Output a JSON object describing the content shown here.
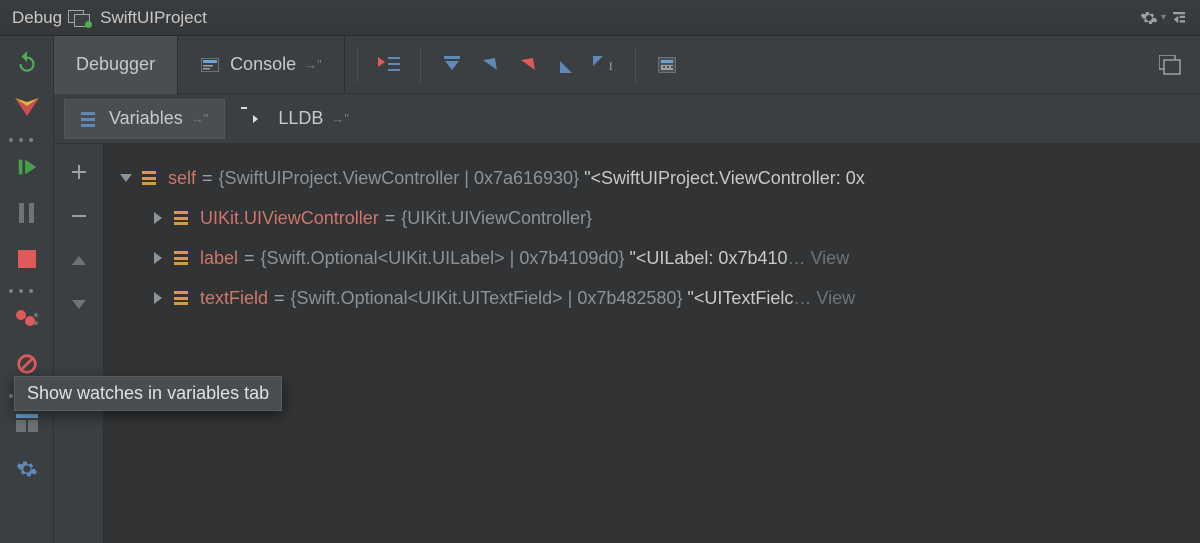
{
  "titleBar": {
    "title": "Debug",
    "projectName": "SwiftUIProject"
  },
  "toolbar": {
    "tabDebugger": "Debugger",
    "tabConsole": "Console"
  },
  "subTabs": {
    "variables": "Variables",
    "lldb": "LLDB"
  },
  "tooltip": "Show watches in variables tab",
  "variables": {
    "root": {
      "name": "self",
      "type": "{SwiftUIProject.ViewController | 0x7a616930}",
      "desc": "\"<SwiftUIProject.ViewController: 0x"
    },
    "children": [
      {
        "name": "UIKit.UIViewController",
        "type": "{UIKit.UIViewController}",
        "desc": ""
      },
      {
        "name": "label",
        "type": "{Swift.Optional<UIKit.UILabel> | 0x7b4109d0}",
        "desc": "\"<UILabel: 0x7b410",
        "trail": "… View"
      },
      {
        "name": "textField",
        "type": "{Swift.Optional<UIKit.UITextField> | 0x7b482580}",
        "desc": "\"<UITextFielc",
        "trail": "… View"
      }
    ]
  }
}
